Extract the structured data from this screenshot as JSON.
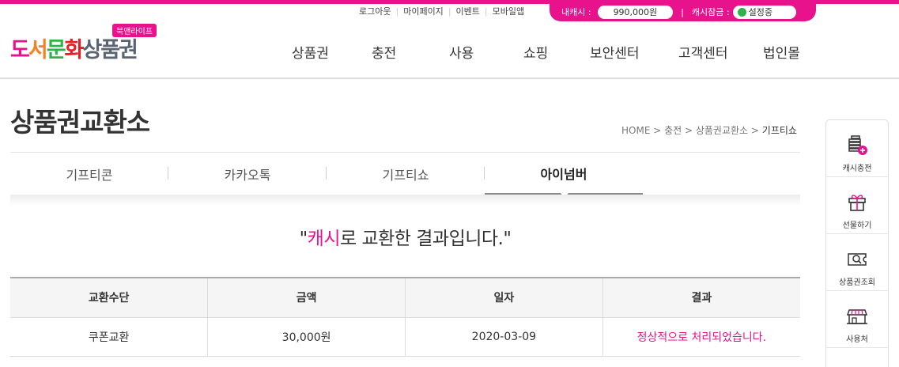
{
  "util_menu": [
    "로그아웃",
    "마이페이지",
    "이벤트",
    "모바일앱"
  ],
  "cash": {
    "label": "내캐시 :",
    "value": "990,000원",
    "lock_label": "캐시잠금 :",
    "lock_status": "설정중",
    "lock_color": "#2db34a"
  },
  "logo": {
    "parts": [
      "도",
      "서",
      "문",
      "화",
      "상품권"
    ],
    "badge": "북앤라이프"
  },
  "gnb": [
    "상품권",
    "충전",
    "사용",
    "쇼핑",
    "보안센터",
    "고객센터",
    "법인몰"
  ],
  "page": {
    "title": "상품권교환소",
    "breadcrumb": "HOME > 충전 > 상품권교환소 > ",
    "breadcrumb_current": "기프티쇼"
  },
  "tabs": [
    "기프티콘",
    "카카오톡",
    "기프티쇼",
    "아이넘버"
  ],
  "active_tab": "아이넘버",
  "result": {
    "quote_open": "\"",
    "highlight": "캐시",
    "rest": "로 교환한 결과입니다.\""
  },
  "table": {
    "headers": [
      "교환수단",
      "금액",
      "일자",
      "결과"
    ],
    "rows": [
      [
        "쿠폰교환",
        "30,000원",
        "2020-03-09",
        "정상적으로 처리되었습니다."
      ]
    ]
  },
  "quick_menu": [
    {
      "label": "캐시충전",
      "icon": "cash-charge-icon"
    },
    {
      "label": "선물하기",
      "icon": "gift-icon"
    },
    {
      "label": "상품권조회",
      "icon": "voucher-search-icon"
    },
    {
      "label": "사용처",
      "icon": "store-icon"
    }
  ],
  "colors": {
    "brand": "#e8138c",
    "success": "#2db34a"
  }
}
